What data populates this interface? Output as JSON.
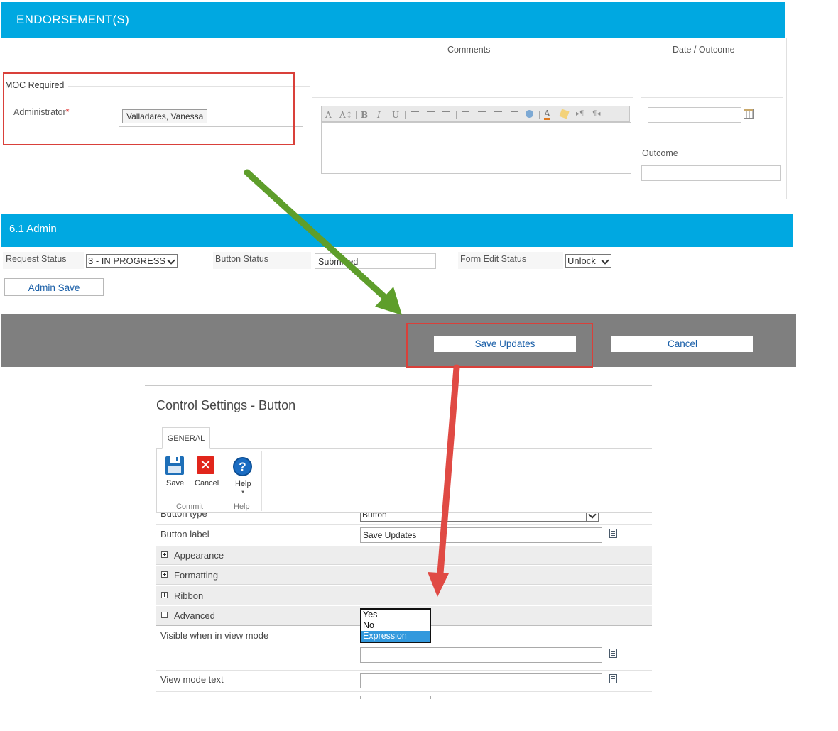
{
  "endorsements": {
    "title": "ENDORSEMENT(S)",
    "col_comments": "Comments",
    "col_date_outcome": "Date / Outcome",
    "moc_required": "MOC Required",
    "administrator_label": "Administrator",
    "required_mark": "*",
    "administrator_value": "Valladares, Vanessa",
    "outcome_label": "Outcome"
  },
  "admin": {
    "title": "6.1 Admin",
    "request_status_label": "Request Status",
    "request_status_value": "3 - IN PROGRESS",
    "button_status_label": "Button Status",
    "button_status_value": "Submitted",
    "form_edit_status_label": "Form Edit Status",
    "form_edit_status_value": "Unlock",
    "admin_save_label": "Admin Save"
  },
  "footer_bar": {
    "save_updates_label": "Save Updates",
    "cancel_label": "Cancel"
  },
  "control_settings": {
    "title": "Control Settings - Button",
    "tab_general": "GENERAL",
    "ribbon": {
      "save": "Save",
      "cancel": "Cancel",
      "commit_group": "Commit",
      "help": "Help",
      "help_group": "Help"
    },
    "button_type_label": "Button type",
    "button_type_value": "Button",
    "button_label_label": "Button label",
    "button_label_value": "Save Updates",
    "sections": {
      "appearance": "Appearance",
      "formatting": "Formatting",
      "ribbon": "Ribbon",
      "advanced": "Advanced"
    },
    "visible_in_view_mode_label": "Visible when in view mode",
    "visible_options": [
      "Yes",
      "No",
      "Expression"
    ],
    "visible_selected": "Expression",
    "view_mode_text_label": "View mode text"
  },
  "colors": {
    "banner": "#00a8e1",
    "footer_bar": "#7f7f7f",
    "highlight_box": "#d9403a",
    "arrow_green": "#5e9e2b",
    "arrow_red": "#e04a44",
    "link_blue": "#1a5fa8",
    "selected_option": "#3399dd"
  },
  "icons": [
    "save-icon",
    "cancel-x-icon",
    "help-question-icon",
    "calendar-icon",
    "document-icon"
  ]
}
